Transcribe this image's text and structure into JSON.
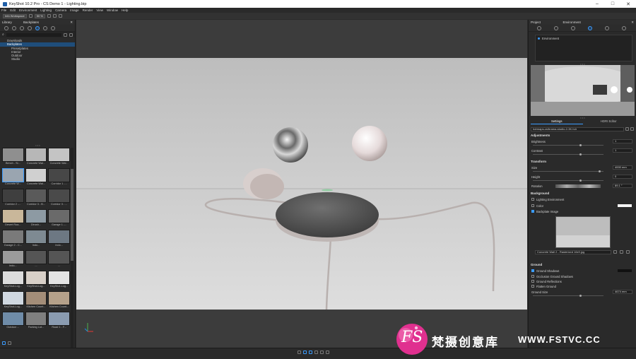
{
  "window": {
    "title": "KeyShot 10.2 Pro - CS Demo 1 - Lighting.bip"
  },
  "menu": [
    "File",
    "Edit",
    "Environment",
    "Lighting",
    "Camera",
    "Image",
    "Render",
    "View",
    "Window",
    "Help"
  ],
  "toolbar": {
    "workspace": "Info Workspace",
    "zoom": "50 %"
  },
  "library": {
    "title": "Library",
    "section": "Backplates",
    "tree": [
      {
        "label": "Downloads",
        "selected": false,
        "sub": false
      },
      {
        "label": "Backplates",
        "selected": true,
        "sub": false
      },
      {
        "label": "Presetplates",
        "selected": false,
        "sub": true
      },
      {
        "label": "Interior",
        "selected": false,
        "sub": true
      },
      {
        "label": "Outdoor",
        "selected": false,
        "sub": true
      },
      {
        "label": "Studio",
        "selected": false,
        "sub": true
      }
    ],
    "thumbs": [
      {
        "label": "Bench - Si...",
        "color": "#8f8f8f"
      },
      {
        "label": "Concrete Wal...",
        "color": "#b7b7b7"
      },
      {
        "label": "Concrete Wal...",
        "color": "#c4c4c4"
      },
      {
        "label": "Concrete W...",
        "color": "#9aa5b0",
        "selected": true
      },
      {
        "label": "Concrete Wal...",
        "color": "#d0d0d0"
      },
      {
        "label": "Corridor 1 -...",
        "color": "#474747"
      },
      {
        "label": "Corridor 2 -...",
        "color": "#3f3f3f"
      },
      {
        "label": "Corridor 3 - B...",
        "color": "#5a5a5a"
      },
      {
        "label": "Corridor 3 - ...",
        "color": "#4a4a4a"
      },
      {
        "label": "Desert Roa...",
        "color": "#c9b79a"
      },
      {
        "label": "Dirush...",
        "color": "#8d9aa3"
      },
      {
        "label": "Garage 1 -...",
        "color": "#6a6a6a"
      },
      {
        "label": "Garage 2 - C...",
        "color": "#7a7a7a"
      },
      {
        "label": "Indo...",
        "color": "#7e8a92"
      },
      {
        "label": "Indo...",
        "color": "#6d7883"
      },
      {
        "label": "Indo...",
        "color": "#9b9b9b"
      },
      {
        "label": "...",
        "color": "#555555"
      },
      {
        "label": "...",
        "color": "#555555"
      },
      {
        "label": "KeyShot-Log...",
        "color": "#dcdcdc"
      },
      {
        "label": "KeyShot-Log...",
        "color": "#d8d0c8"
      },
      {
        "label": "KeyShot-Log...",
        "color": "#e4e4e4"
      },
      {
        "label": "KeyShot-Log...",
        "color": "#d0d8e0"
      },
      {
        "label": "Kitchen Count...",
        "color": "#a38d78"
      },
      {
        "label": "Kitchen Count...",
        "color": "#b5a18a"
      },
      {
        "label": "Outdoor ...",
        "color": "#6f8ca8"
      },
      {
        "label": "Parking Lot...",
        "color": "#7f7f7f"
      },
      {
        "label": "Road 1 - F...",
        "color": "#8a9bb0"
      }
    ]
  },
  "project": {
    "title": "Project",
    "tab": "Environment",
    "env_name": "Environment",
    "subtabs": [
      "Settings",
      "HDRI Editor"
    ],
    "hdri_file": "hdrmaps-cs/brama-studio-2-3K.hdr",
    "adjustments": {
      "title": "Adjustments",
      "brightness_label": "Brightness",
      "brightness": "1",
      "contrast_label": "Contrast",
      "contrast": "1"
    },
    "transform": {
      "title": "Transform",
      "size_label": "Size",
      "size": "4000 mm",
      "height_label": "Height",
      "height": "0",
      "rotation_label": "Rotation",
      "rotation": "89.1 °"
    },
    "background": {
      "title": "Background",
      "opt1": "Lighting Environment",
      "opt2": "Color",
      "opt3": "Backplate Image",
      "image_file": "Concrete Wall 2 - Rasterized 16x9.jpg"
    },
    "ground": {
      "title": "Ground",
      "opt1": "Ground Shadows",
      "opt2": "Occlusion Ground Shadows",
      "opt3": "Ground Reflections",
      "opt4": "Flatten Ground",
      "size_label": "Ground Size",
      "size": "4674 mm"
    }
  },
  "watermark": {
    "logo": "FS",
    "text": "梵摄创意库",
    "url": "WWW.FSTVC.CC"
  },
  "colors": {
    "accent": "#3b9cff",
    "panel": "#2a2a2a",
    "viewport": "#3c3c3c"
  }
}
